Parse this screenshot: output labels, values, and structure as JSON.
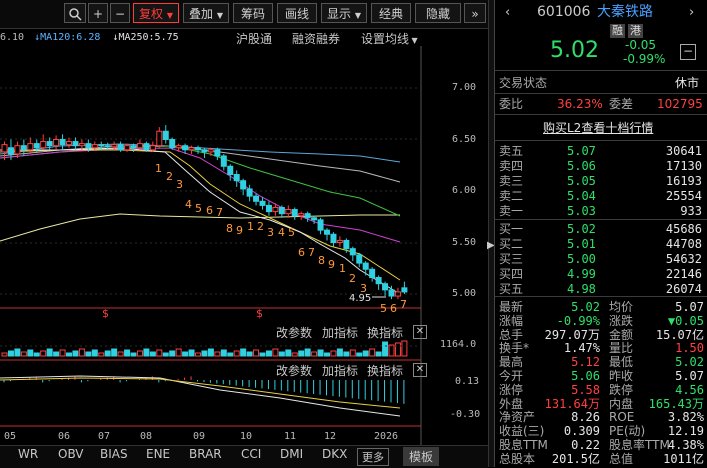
{
  "toolbar": {
    "restore_label": "复权",
    "overlay_label": "叠加",
    "chips_label": "筹码",
    "draw_label": "画线",
    "display_label": "显示",
    "classic_label": "经典",
    "hide_label": "隐藏",
    "plus": "+",
    "minus": "−",
    "more": "»"
  },
  "ma_line": {
    "prefix": "6.10",
    "ma120": "MA120:6.28",
    "ma250": "MA250:5.75",
    "hgt": "沪股通",
    "margin": "融资融券",
    "set_ma": "设置均线"
  },
  "price_axis": [
    "7.00",
    "6.50",
    "6.00",
    "5.50",
    "5.00"
  ],
  "volume_axis": "1164.0",
  "macd_axis": [
    "0.13",
    "-0.30"
  ],
  "panel_controls": {
    "params": "改参数",
    "add_ind": "加指标",
    "switch_ind": "换指标"
  },
  "x_axis": [
    "05",
    "06",
    "07",
    "08",
    "09",
    "10",
    "11",
    "12",
    "2026"
  ],
  "bottom_tabs": [
    "WR",
    "OBV",
    "BIAS",
    "ENE",
    "BRAR",
    "CCI",
    "DMI",
    "DKX",
    "更多",
    "模板"
  ],
  "chart_markers": {
    "low_label": "4.95",
    "seq1": [
      "1",
      "2",
      "3",
      "4",
      "5",
      "6",
      "7"
    ],
    "seq2": [
      "8",
      "9",
      "1",
      "2",
      "3",
      "4",
      "5"
    ],
    "seq3": [
      "6",
      "7",
      "8",
      "9",
      "1",
      "2",
      "3"
    ],
    "seq4": [
      "5",
      "6",
      "7"
    ],
    "s_mark": "$"
  },
  "stock": {
    "code": "601006",
    "name": "大秦铁路",
    "badge1": "融",
    "badge2": "港",
    "price": "5.02",
    "change": "-0.05",
    "change_pct": "-0.99%",
    "status_label": "交易状态",
    "status_value": "休市",
    "ratio_label": "委比",
    "ratio_value": "36.23%",
    "diff_label": "委差",
    "diff_value": "102795",
    "l2_link": "购买L2查看十档行情"
  },
  "asks": [
    {
      "label": "卖五",
      "price": "5.07",
      "vol": "30641"
    },
    {
      "label": "卖四",
      "price": "5.06",
      "vol": "17130"
    },
    {
      "label": "卖三",
      "price": "5.05",
      "vol": "16193"
    },
    {
      "label": "卖二",
      "price": "5.04",
      "vol": "25554"
    },
    {
      "label": "卖一",
      "price": "5.03",
      "vol": "933"
    }
  ],
  "bids": [
    {
      "label": "买一",
      "price": "5.02",
      "vol": "45686"
    },
    {
      "label": "买二",
      "price": "5.01",
      "vol": "44708"
    },
    {
      "label": "买三",
      "price": "5.00",
      "vol": "54632"
    },
    {
      "label": "买四",
      "price": "4.99",
      "vol": "22146"
    },
    {
      "label": "买五",
      "price": "4.98",
      "vol": "26074"
    }
  ],
  "stats": [
    {
      "l1": "最新",
      "v1": "5.02",
      "c1": "green",
      "l2": "均价",
      "v2": "5.07",
      "c2": "white"
    },
    {
      "l1": "涨幅",
      "v1": "-0.99%",
      "c1": "green",
      "l2": "涨跌",
      "v2": "▼0.05",
      "c2": "green"
    },
    {
      "l1": "总手",
      "v1": "297.07万",
      "c1": "white",
      "l2": "金额",
      "v2": "15.07亿",
      "c2": "white"
    },
    {
      "l1": "换手*",
      "v1": "1.47%",
      "c1": "white",
      "l2": "量比",
      "v2": "1.50",
      "c2": "red"
    },
    {
      "l1": "最高",
      "v1": "5.12",
      "c1": "red",
      "l2": "最低",
      "v2": "5.02",
      "c2": "green"
    },
    {
      "l1": "今开",
      "v1": "5.06",
      "c1": "green",
      "l2": "昨收",
      "v2": "5.07",
      "c2": "white"
    },
    {
      "l1": "涨停",
      "v1": "5.58",
      "c1": "red",
      "l2": "跌停",
      "v2": "4.56",
      "c2": "green"
    },
    {
      "l1": "外盘",
      "v1": "131.64万",
      "c1": "red",
      "l2": "内盘",
      "v2": "165.43万",
      "c2": "green"
    },
    {
      "l1": "净资产",
      "v1": "8.26",
      "c1": "white",
      "l2": "ROE",
      "v2": "3.82%",
      "c2": "white"
    },
    {
      "l1": "收益(三)",
      "v1": "0.309",
      "c1": "white",
      "l2": "PE(动)",
      "v2": "12.19",
      "c2": "white"
    },
    {
      "l1": "股息TTM",
      "v1": "0.22",
      "c1": "white",
      "l2": "股息率TTM",
      "v2": "4.38%",
      "c2": "white"
    },
    {
      "l1": "总股本",
      "v1": "201.5亿",
      "c1": "white",
      "l2": "总值",
      "v2": "1011亿",
      "c2": "white"
    }
  ]
}
